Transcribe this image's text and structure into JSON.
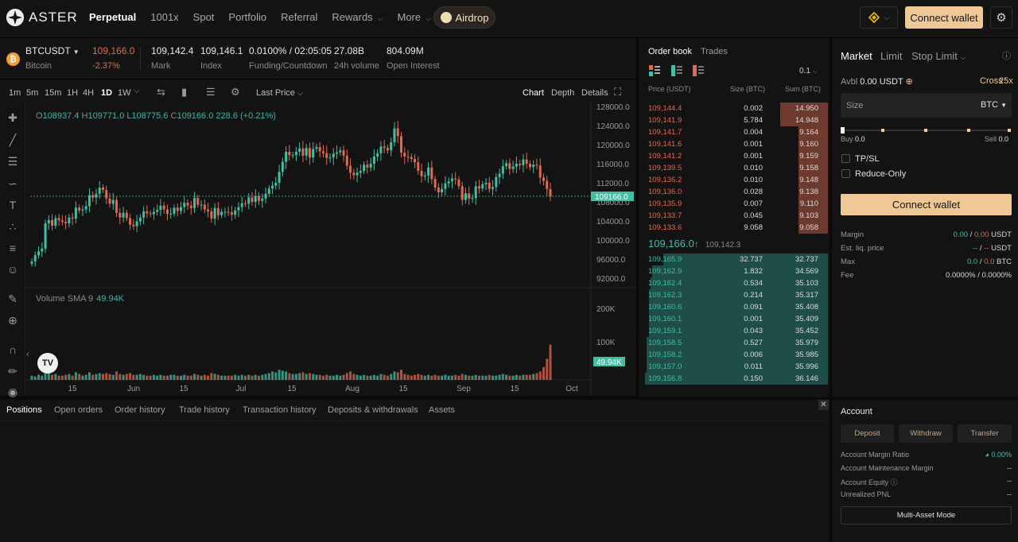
{
  "brand": {
    "name": "ASTER"
  },
  "nav": {
    "items": [
      {
        "label": "Perpetual",
        "active": true,
        "dropdown": false
      },
      {
        "label": "1001x",
        "active": false,
        "dropdown": false
      },
      {
        "label": "Spot",
        "active": false,
        "dropdown": false
      },
      {
        "label": "Portfolio",
        "active": false,
        "dropdown": false
      },
      {
        "label": "Referral",
        "active": false,
        "dropdown": false
      },
      {
        "label": "Rewards",
        "active": false,
        "dropdown": true
      },
      {
        "label": "More",
        "active": false,
        "dropdown": true
      }
    ],
    "airdrop": "Airdrop",
    "connect": "Connect wallet"
  },
  "colors": {
    "accent": "#f0c896",
    "up": "#3fbfa6",
    "down": "#e06a4f",
    "bg": "#131313"
  },
  "ticker": {
    "symbol": "BTCUSDT",
    "name": "Bitcoin",
    "last": "109,166.0",
    "change": "-2.37%",
    "mark": "109,142.4",
    "mark_label": "Mark",
    "index": "109,146.1",
    "index_label": "Index",
    "funding": "0.0100% / 02:05:05",
    "funding_label": "Funding/Countdown",
    "volume": "27.08B",
    "volume_label": "24h volume",
    "oi": "804.09M",
    "oi_label": "Open Interest"
  },
  "chart_toolbar": {
    "timeframes": [
      "1m",
      "5m",
      "15m",
      "1H",
      "4H",
      "1D",
      "1W"
    ],
    "active_tf": "1D",
    "price_source": "Last Price",
    "views": [
      "Chart",
      "Depth",
      "Details"
    ],
    "active_view": "Chart"
  },
  "ohlc": {
    "o": "O",
    "o_val": "108937.4",
    "h": "H",
    "h_val": "109771.0",
    "l": "L",
    "l_val": "108775.6",
    "c": "C",
    "c_val": "109166.0",
    "chg": "228.6 (+0.21%)"
  },
  "volume_label": {
    "name": "Volume SMA 9",
    "value": "49.94K"
  },
  "chart_data": {
    "type": "candlestick",
    "price_axis": {
      "ticks": [
        "128000.0",
        "124000.0",
        "120000.0",
        "116000.0",
        "112000.0",
        "108000.0",
        "104000.0",
        "100000.0",
        "96000.0",
        "92000.0"
      ],
      "min": 90000,
      "max": 129000
    },
    "last_price_label": "109166.0",
    "volume_axis": {
      "ticks": [
        "200K",
        "100K"
      ]
    },
    "volume_label_value": "49.94K",
    "x_ticks": [
      "15",
      "Jun",
      "15",
      "Jul",
      "15",
      "Aug",
      "15",
      "Sep",
      "15",
      "Oct"
    ],
    "close": [
      95500,
      96800,
      97600,
      98200,
      103500,
      104200,
      103000,
      104600,
      104100,
      103800,
      103500,
      104700,
      104500,
      106800,
      106200,
      106400,
      107100,
      109400,
      108900,
      109700,
      111000,
      110500,
      108700,
      107600,
      108400,
      105700,
      104700,
      105700,
      104600,
      103200,
      102900,
      103900,
      104700,
      106000,
      105600,
      105400,
      105900,
      106300,
      107200,
      106400,
      105500,
      105500,
      106800,
      106100,
      106900,
      107800,
      107200,
      106700,
      108800,
      107400,
      107400,
      106400,
      106000,
      104500,
      106700,
      105200,
      105900,
      105900,
      105800,
      105300,
      106200,
      106900,
      107700,
      107600,
      108900,
      108000,
      109200,
      108200,
      108700,
      109700,
      110800,
      111400,
      112000,
      114300,
      116400,
      118500,
      117800,
      117800,
      118500,
      119200,
      117700,
      119300,
      117300,
      119100,
      119500,
      118600,
      118200,
      117200,
      117300,
      118100,
      118400,
      118800,
      117700,
      115600,
      114100,
      113600,
      114100,
      114500,
      115800,
      115200,
      116000,
      117500,
      118200,
      119600,
      119300,
      118800,
      120500,
      123400,
      121800,
      118300,
      117500,
      117400,
      117000,
      116300,
      114500,
      113400,
      113500,
      115200,
      112800,
      111000,
      110000,
      110700,
      111900,
      112300,
      112900,
      112700,
      111300,
      108400,
      109800,
      108700,
      108800,
      111300,
      110800,
      111700,
      112000,
      110700,
      111100,
      113200,
      113900,
      115500,
      116100,
      114900,
      115400,
      116000,
      115700,
      116900,
      116000,
      115300,
      115800,
      115600,
      113100,
      112400,
      110700,
      109166
    ],
    "volume_rel": [
      0.05,
      0.04,
      0.06,
      0.05,
      0.12,
      0.08,
      0.06,
      0.07,
      0.05,
      0.05,
      0.06,
      0.07,
      0.05,
      0.09,
      0.07,
      0.05,
      0.06,
      0.09,
      0.06,
      0.07,
      0.08,
      0.07,
      0.08,
      0.07,
      0.06,
      0.1,
      0.07,
      0.06,
      0.07,
      0.08,
      0.06,
      0.06,
      0.07,
      0.06,
      0.05,
      0.05,
      0.06,
      0.05,
      0.06,
      0.05,
      0.05,
      0.06,
      0.06,
      0.05,
      0.05,
      0.06,
      0.05,
      0.05,
      0.07,
      0.06,
      0.05,
      0.06,
      0.05,
      0.08,
      0.07,
      0.06,
      0.05,
      0.05,
      0.05,
      0.05,
      0.06,
      0.05,
      0.06,
      0.05,
      0.06,
      0.05,
      0.06,
      0.05,
      0.06,
      0.07,
      0.08,
      0.1,
      0.09,
      0.12,
      0.11,
      0.1,
      0.08,
      0.07,
      0.07,
      0.08,
      0.09,
      0.07,
      0.08,
      0.07,
      0.06,
      0.06,
      0.05,
      0.06,
      0.05,
      0.05,
      0.06,
      0.05,
      0.06,
      0.08,
      0.1,
      0.07,
      0.06,
      0.05,
      0.06,
      0.05,
      0.05,
      0.06,
      0.05,
      0.07,
      0.06,
      0.05,
      0.07,
      0.1,
      0.09,
      0.12,
      0.07,
      0.06,
      0.05,
      0.06,
      0.07,
      0.06,
      0.05,
      0.06,
      0.05,
      0.06,
      0.05,
      0.05,
      0.06,
      0.05,
      0.05,
      0.06,
      0.05,
      0.07,
      0.06,
      0.05,
      0.05,
      0.06,
      0.05,
      0.05,
      0.05,
      0.06,
      0.05,
      0.05,
      0.06,
      0.07,
      0.06,
      0.05,
      0.05,
      0.06,
      0.05,
      0.06,
      0.06,
      0.06,
      0.07,
      0.08,
      0.1,
      0.15,
      0.25,
      0.42,
      0.3,
      0.66,
      0.8,
      0.95
    ]
  },
  "orderbook": {
    "tabs": [
      "Order book",
      "Trades"
    ],
    "precision": "0.1",
    "headers": {
      "price": "Price (USDT)",
      "size": "Size (BTC)",
      "sum": "Sum (BTC)"
    },
    "asks": [
      {
        "price": "109,144.4",
        "size": "0.002",
        "sum": "14.950",
        "depth": 1.0
      },
      {
        "price": "109,141.9",
        "size": "5.784",
        "sum": "14.948",
        "depth": 1.0
      },
      {
        "price": "109,141.7",
        "size": "0.004",
        "sum": "9.164",
        "depth": 0.61
      },
      {
        "price": "109,141.6",
        "size": "0.001",
        "sum": "9.160",
        "depth": 0.61
      },
      {
        "price": "109,141.2",
        "size": "0.001",
        "sum": "9.159",
        "depth": 0.61
      },
      {
        "price": "109,139.5",
        "size": "0.010",
        "sum": "9.158",
        "depth": 0.61
      },
      {
        "price": "109,136.2",
        "size": "0.010",
        "sum": "9.148",
        "depth": 0.61
      },
      {
        "price": "109,136.0",
        "size": "0.028",
        "sum": "9.138",
        "depth": 0.61
      },
      {
        "price": "109,135.9",
        "size": "0.007",
        "sum": "9.110",
        "depth": 0.61
      },
      {
        "price": "109,133.7",
        "size": "0.045",
        "sum": "9.103",
        "depth": 0.61
      },
      {
        "price": "109,133.6",
        "size": "9.058",
        "sum": "9.058",
        "depth": 0.61
      }
    ],
    "mid": {
      "price": "109,166.0",
      "arrow": "↑",
      "mark": "109,142.3"
    },
    "bids": [
      {
        "price": "109,165.9",
        "size": "32.737",
        "sum": "32.737",
        "depth": 0.9
      },
      {
        "price": "109,162.9",
        "size": "1.832",
        "sum": "34.569",
        "depth": 0.96
      },
      {
        "price": "109,162.4",
        "size": "0.534",
        "sum": "35.103",
        "depth": 0.97
      },
      {
        "price": "109,162.3",
        "size": "0.214",
        "sum": "35.317",
        "depth": 0.98
      },
      {
        "price": "109,160.6",
        "size": "0.091",
        "sum": "35.408",
        "depth": 0.98
      },
      {
        "price": "109,160.1",
        "size": "0.001",
        "sum": "35.409",
        "depth": 0.98
      },
      {
        "price": "109,159.1",
        "size": "0.043",
        "sum": "35.452",
        "depth": 0.98
      },
      {
        "price": "109,158.5",
        "size": "0.527",
        "sum": "35.979",
        "depth": 0.99
      },
      {
        "price": "109,158.2",
        "size": "0.006",
        "sum": "35.985",
        "depth": 0.99
      },
      {
        "price": "109,157.0",
        "size": "0.011",
        "sum": "35.996",
        "depth": 0.99
      },
      {
        "price": "109,156.8",
        "size": "0.150",
        "sum": "36.146",
        "depth": 1.0
      }
    ]
  },
  "order_panel": {
    "tabs": [
      "Market",
      "Limit",
      "Stop Limit"
    ],
    "active_tab": "Market",
    "avbl_label": "Avbl",
    "avbl_value": "0.00 USDT",
    "margin_mode": "Cross",
    "leverage": "25x",
    "size_placeholder": "Size",
    "size_unit": "BTC",
    "buy_label": "Buy",
    "buy_value": "0.0",
    "sell_label": "Sell",
    "sell_value": "0.0",
    "tpsl": "TP/SL",
    "reduce_only": "Reduce-Only",
    "connect": "Connect wallet",
    "rows": [
      {
        "label": "Margin",
        "a": "0.00",
        "sep": "/",
        "b": "0.00",
        "unit": "USDT"
      },
      {
        "label": "Est. liq. price",
        "a": "--",
        "sep": "/",
        "b": "--",
        "unit": "USDT"
      },
      {
        "label": "Max",
        "a": "0.0",
        "sep": "/",
        "b": "0.0",
        "unit": "BTC"
      },
      {
        "label": "Fee",
        "a": "0.0000%",
        "sep": "/",
        "b": "0.0000%",
        "unit": ""
      }
    ]
  },
  "bottom": {
    "tabs": [
      "Positions",
      "Open orders",
      "Order history",
      "Trade history",
      "Transaction history",
      "Deposits & withdrawals",
      "Assets"
    ],
    "active": "Positions"
  },
  "account": {
    "title": "Account",
    "buttons": [
      "Deposit",
      "Withdraw",
      "Transfer"
    ],
    "rows": [
      {
        "label": "Account Margin Ratio",
        "value": "0.00%"
      },
      {
        "label": "Account Maintenance Margin",
        "value": "--"
      },
      {
        "label": "Account Equity",
        "value": "--"
      },
      {
        "label": "Unrealized PNL",
        "value": "--"
      }
    ],
    "multi_asset": "Multi-Asset Mode"
  }
}
